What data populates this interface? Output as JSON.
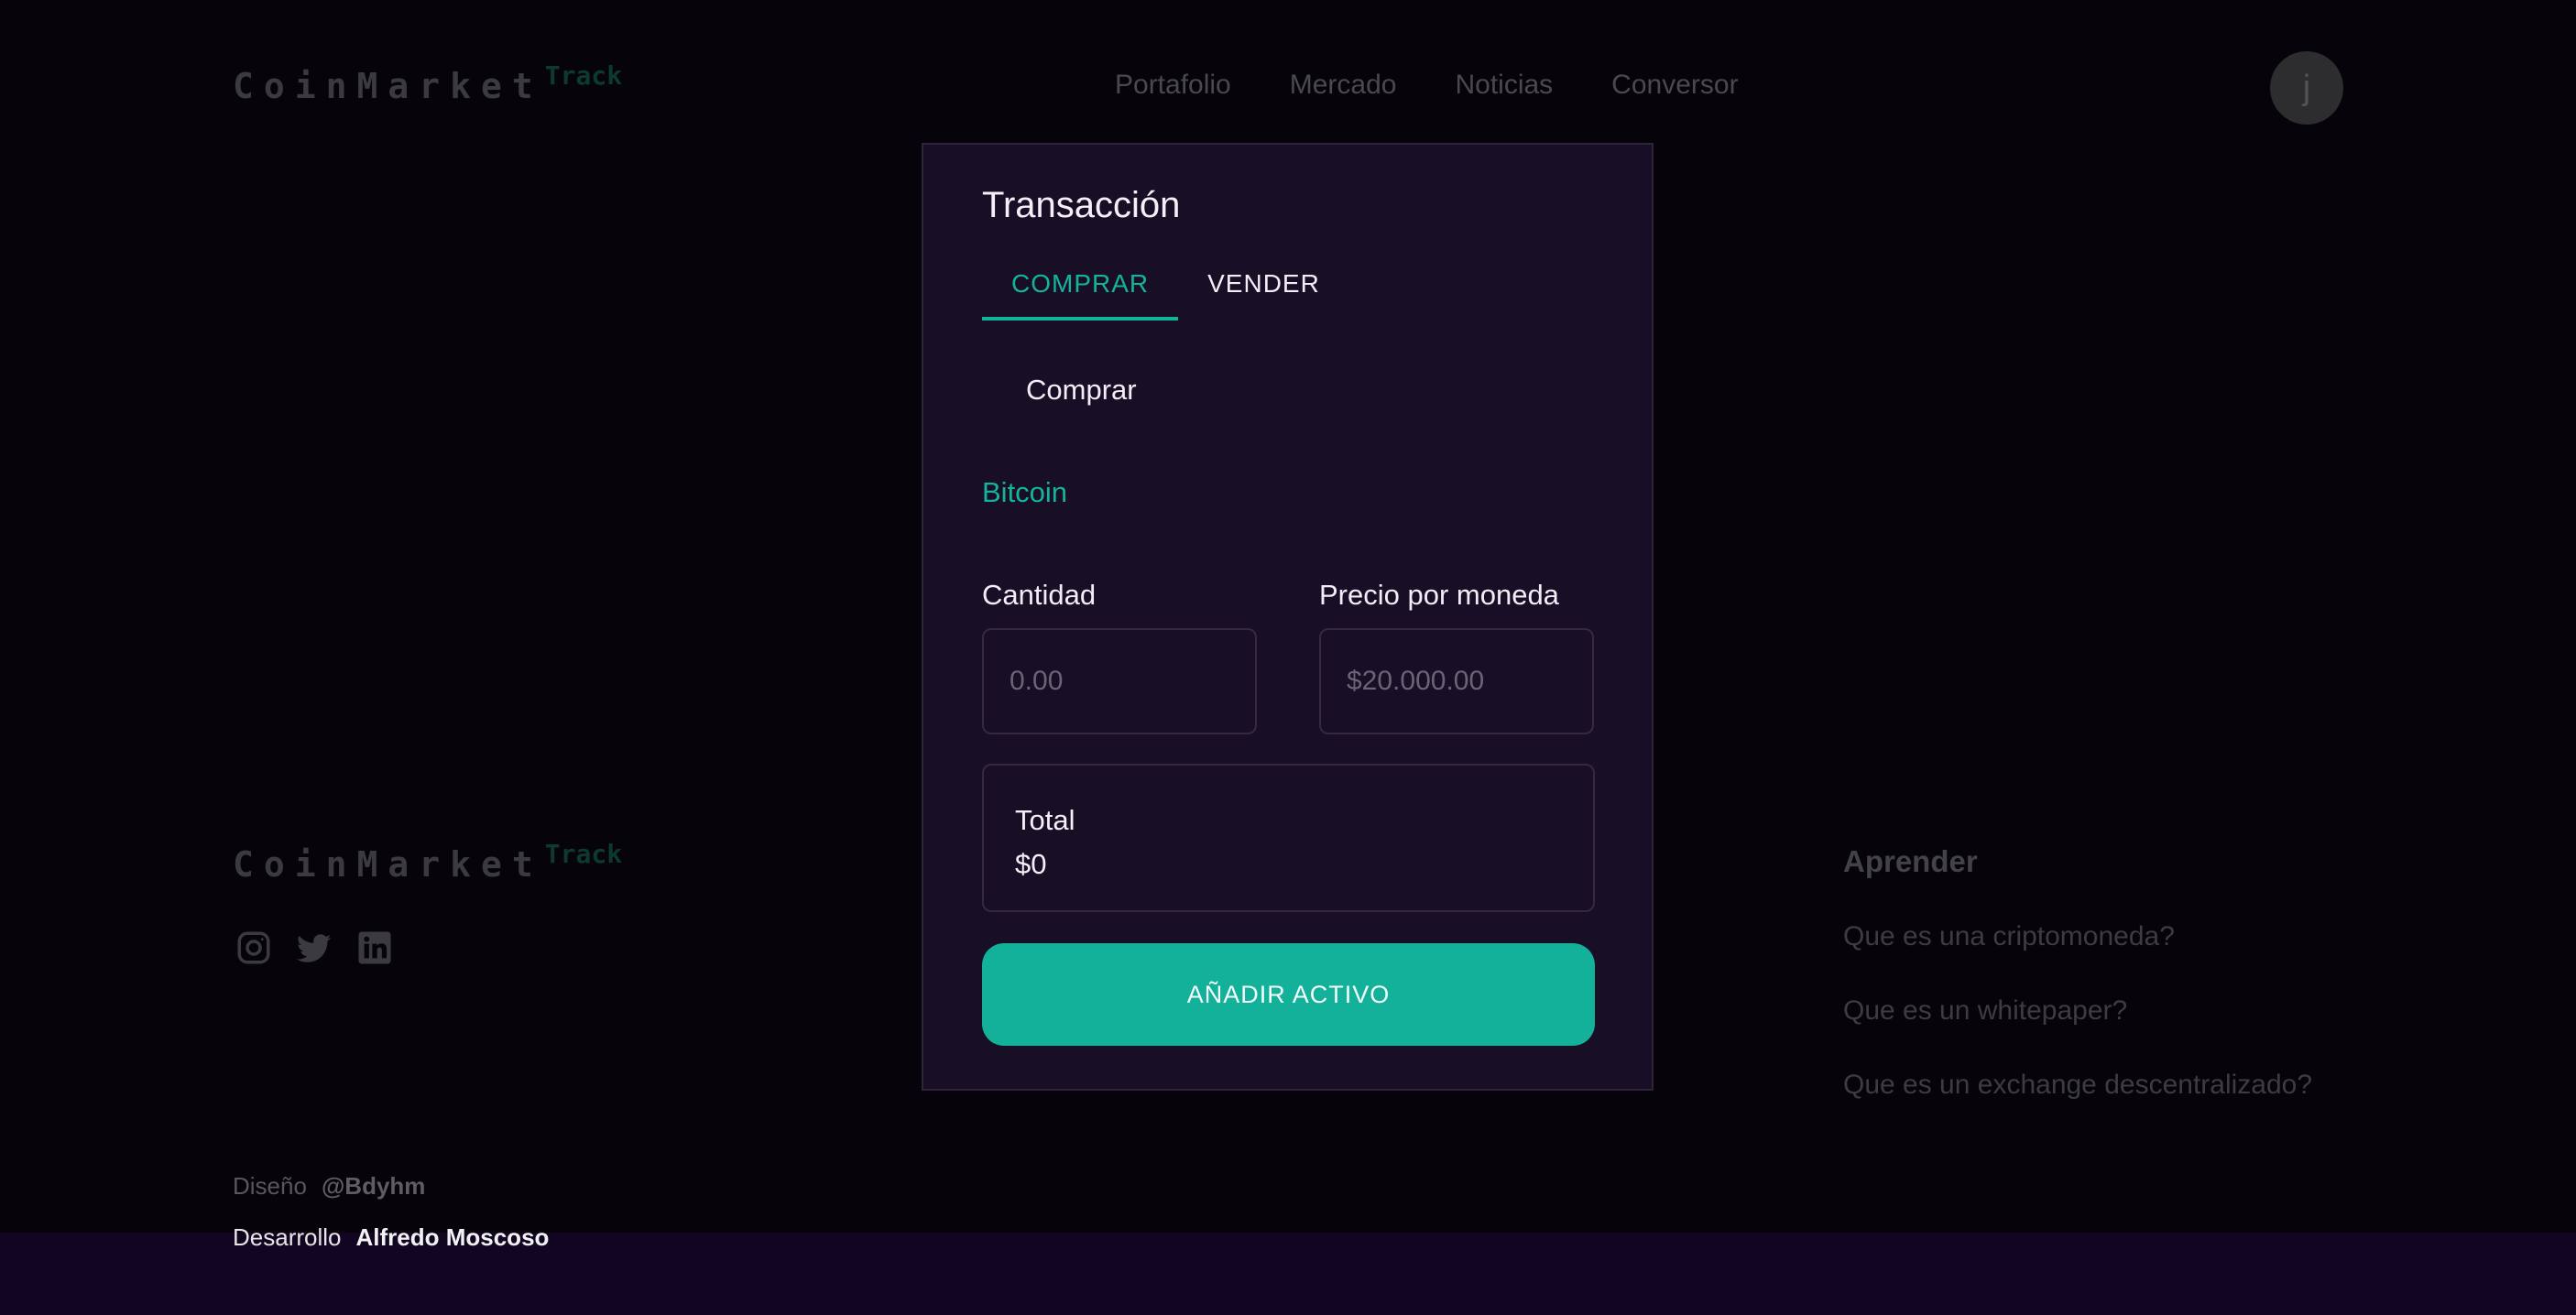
{
  "header": {
    "logo_main": "CoinMarket",
    "logo_sub": "Track",
    "nav": [
      "Portafolio",
      "Mercado",
      "Noticias",
      "Conversor"
    ],
    "avatar_initial": "j"
  },
  "footer": {
    "logo_main": "CoinMarket",
    "logo_sub": "Track",
    "social_icons": [
      "instagram-icon",
      "twitter-icon",
      "linkedin-icon"
    ],
    "learn_title": "Aprender",
    "learn_links": [
      "Que es una criptomoneda?",
      "Que es un whitepaper?",
      "Que es un exchange descentralizado?"
    ],
    "design_label": "Diseño",
    "design_name": "@Bdyhm",
    "dev_label": "Desarrollo",
    "dev_name": "Alfredo Moscoso"
  },
  "modal": {
    "title": "Transacción",
    "tabs": [
      "COMPRAR",
      "VENDER"
    ],
    "active_tab": "COMPRAR",
    "action_label": "Comprar",
    "coin": "Bitcoin",
    "quantity_label": "Cantidad",
    "quantity_placeholder": "0.00",
    "price_label": "Precio por moneda",
    "price_placeholder": "$20.000.00",
    "total_label": "Total",
    "total_value": "$0",
    "submit_label": "AÑADIR ACTIVO"
  },
  "colors": {
    "accent": "#14b39b",
    "modal_bg": "#180e26",
    "page_bg": "#06040a",
    "bottom_band": "#120522"
  }
}
